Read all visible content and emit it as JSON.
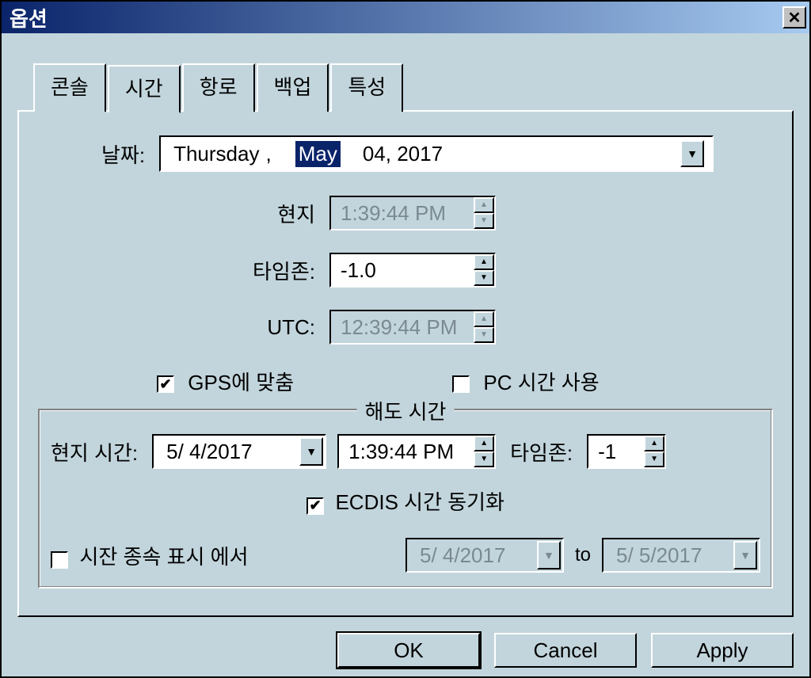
{
  "window": {
    "title": "옵션"
  },
  "tabs": {
    "console": "콘솔",
    "time": "시간",
    "route": "항로",
    "backup": "백업",
    "property": "특성"
  },
  "fields": {
    "date_label": "날짜:",
    "date_weekday": "Thursday",
    "date_comma": ",",
    "date_month": "May",
    "date_rest": "04, 2017",
    "local_label": "현지",
    "local_value": "1:39:44 PM",
    "tz_label": "타임존:",
    "tz_value": "-1.0",
    "utc_label": "UTC:",
    "utc_value": "12:39:44 PM",
    "gps_sync": "GPS에 맞춤",
    "pc_time": "PC 시간 사용"
  },
  "chart_time": {
    "legend": "해도 시간",
    "local_label": "현지 시간:",
    "local_date": "5/ 4/2017",
    "local_time": "1:39:44 PM",
    "tz_label": "타임존:",
    "tz_value": "-1",
    "ecdis_sync": "ECDIS 시간 동기화",
    "dep_label": "시잔 종속 표시 에서",
    "dep_from": "5/ 4/2017",
    "dep_to_word": "to",
    "dep_to": "5/ 5/2017"
  },
  "buttons": {
    "ok": "OK",
    "cancel": "Cancel",
    "apply": "Apply"
  }
}
